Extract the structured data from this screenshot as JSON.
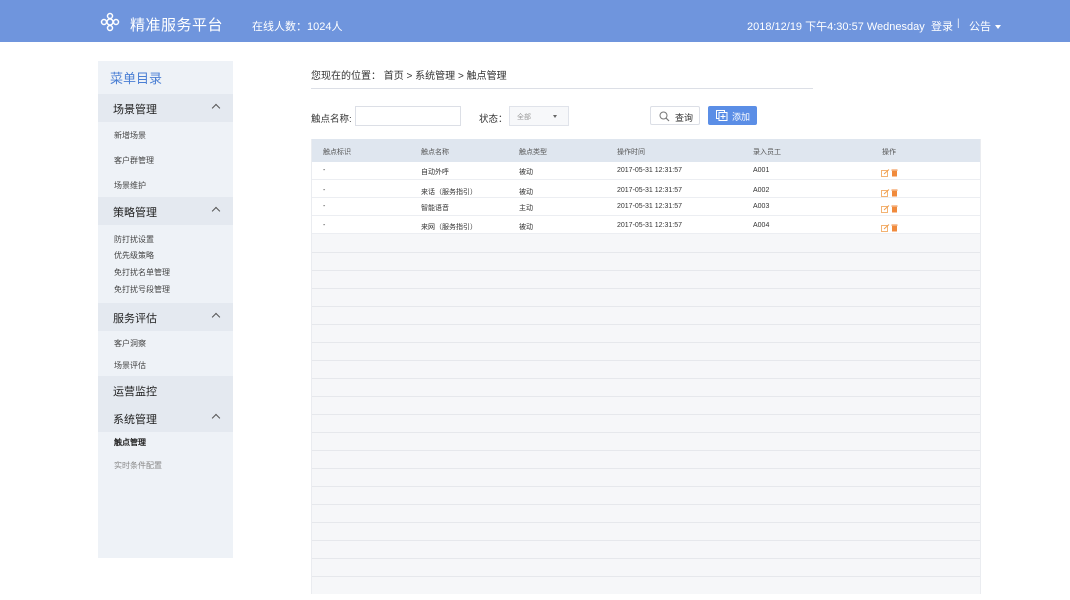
{
  "header": {
    "brand": "精准服务平台",
    "online": "在线人数：1024人",
    "datetime": "2018/12/19 下午4:30:57 Wednesday",
    "login": "登录",
    "separator": "|",
    "notice": "公告",
    "bg_color": "#6f95dd"
  },
  "sidebar": {
    "title": "菜单目录",
    "groups": [
      {
        "label": "场景管理",
        "items": [
          "新增场景",
          "客户群管理",
          "场景维护"
        ]
      },
      {
        "label": "策略管理",
        "items": [
          "防打扰设置",
          "优先级策略",
          "免打扰名单管理",
          "免打扰号段管理"
        ]
      },
      {
        "label": "服务评估",
        "items": [
          "客户洞察",
          "场景评估"
        ]
      },
      {
        "label": "运营监控",
        "items": []
      },
      {
        "label": "系统管理",
        "items": [
          "触点管理",
          "实时条件配置"
        ]
      }
    ]
  },
  "breadcrumb": "您现在的位置： 首页 > 系统管理 > 触点管理",
  "filters": {
    "name_label": "触点名称:",
    "name_value": "",
    "status_label": "状态：",
    "status_value": "全部",
    "query_label": "查询",
    "add_label": "添加"
  },
  "table": {
    "columns": [
      "触点标识",
      "触点名称",
      "触点类型",
      "操作时间",
      "录入员工",
      "操作"
    ],
    "rows": [
      {
        "id": "-",
        "name": "自动外呼",
        "type": "被动",
        "time": "2017-05-31 12:31:57",
        "staff": "A001"
      },
      {
        "id": "-",
        "name": "来话（服务指引）",
        "type": "被动",
        "time": "2017-05-31 12:31:57",
        "staff": "A002"
      },
      {
        "id": "-",
        "name": "智能语音",
        "type": "主动",
        "time": "2017-05-31 12:31:57",
        "staff": "A003"
      },
      {
        "id": "-",
        "name": "来网（服务指引）",
        "type": "被动",
        "time": "2017-05-31 12:31:57",
        "staff": "A004"
      }
    ]
  },
  "colors": {
    "accent": "#5b8ee6",
    "menu_title": "#4b7fd4",
    "edit_icon": "#f0a050",
    "delete_icon": "#f08a3c"
  }
}
